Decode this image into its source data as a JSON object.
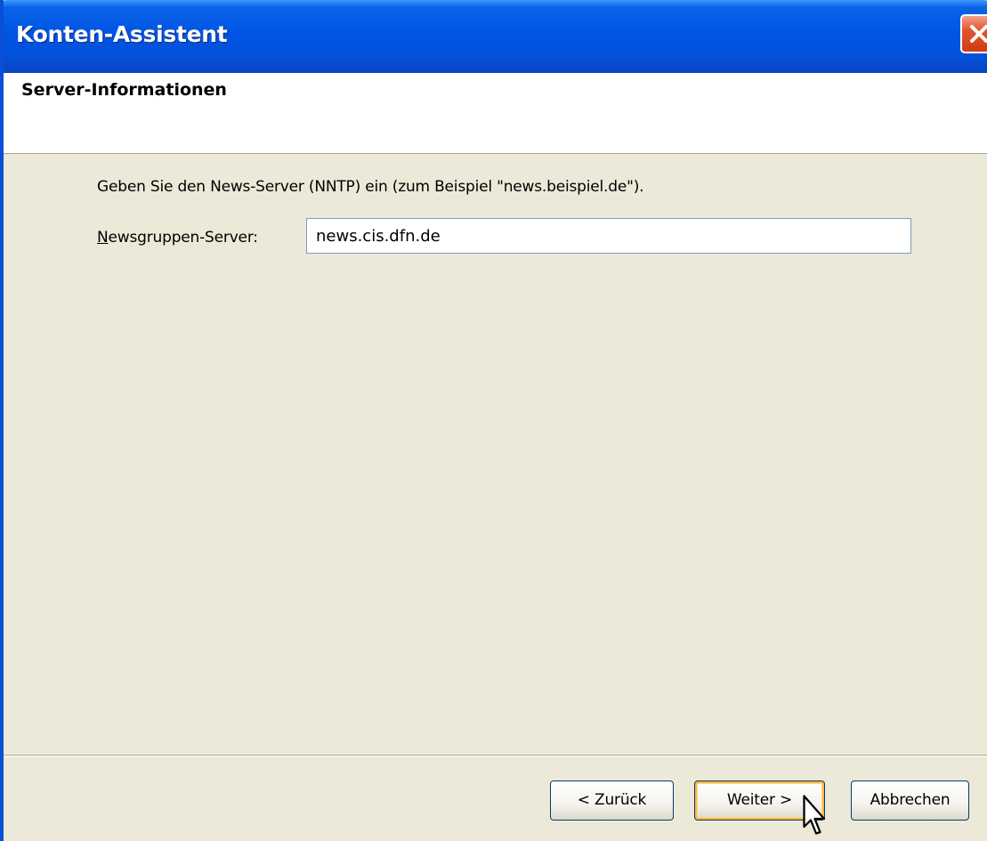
{
  "window": {
    "title": "Konten-Assistent"
  },
  "header": {
    "title": "Server-Informationen"
  },
  "content": {
    "instruction": "Geben Sie den News-Server (NNTP) ein (zum Beispiel \"news.beispiel.de\").",
    "server_label_accel": "N",
    "server_label_rest": "ewsgruppen-Server:",
    "server_value": "news.cis.dfn.de"
  },
  "buttons": {
    "back": "< Zurück",
    "next": "Weiter >",
    "cancel": "Abbrechen"
  },
  "icons": {
    "close": "close-icon",
    "cursor": "mouse-pointer-icon"
  },
  "colors": {
    "titlebar": "#0055e5",
    "close_button": "#e2542d",
    "dialog_background": "#ece9d8",
    "header_background": "#ffffff"
  }
}
